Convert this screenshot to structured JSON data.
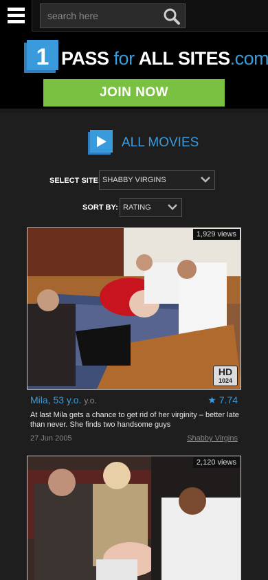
{
  "topbar": {
    "menu_icon": "hamburger-menu-icon",
    "search_placeholder": "search here",
    "search_icon": "search-icon"
  },
  "header": {
    "logo_number": "1",
    "logo_pass": "PASS",
    "logo_for": "for",
    "logo_all_sites": "ALL SITES",
    "logo_dotcom": ".com",
    "join_label": "JOIN NOW"
  },
  "section": {
    "title": "ALL MOVIES",
    "icon": "play-icon"
  },
  "filters": {
    "site_label": "SELECT SITE:",
    "site_value": "SHABBY VIRGINS",
    "sort_label": "SORT BY:",
    "sort_value": "RATING"
  },
  "movies": [
    {
      "views": "1,929 views",
      "hd": "HD",
      "hd_res": "1024",
      "title": "Mila, 53 y.o.",
      "title_suffix": "y.o.",
      "rating": "★ 7.74",
      "description": "At last Mila gets a chance to get rid of her virginity – better late than never. She finds two handsome guys",
      "date": "27 Jun 2005",
      "site": "Shabby Virgins"
    },
    {
      "views": "2,120 views"
    }
  ],
  "colors": {
    "accent_blue": "#3a9bdc",
    "join_green": "#7ac142",
    "background": "#1e1e1e"
  }
}
